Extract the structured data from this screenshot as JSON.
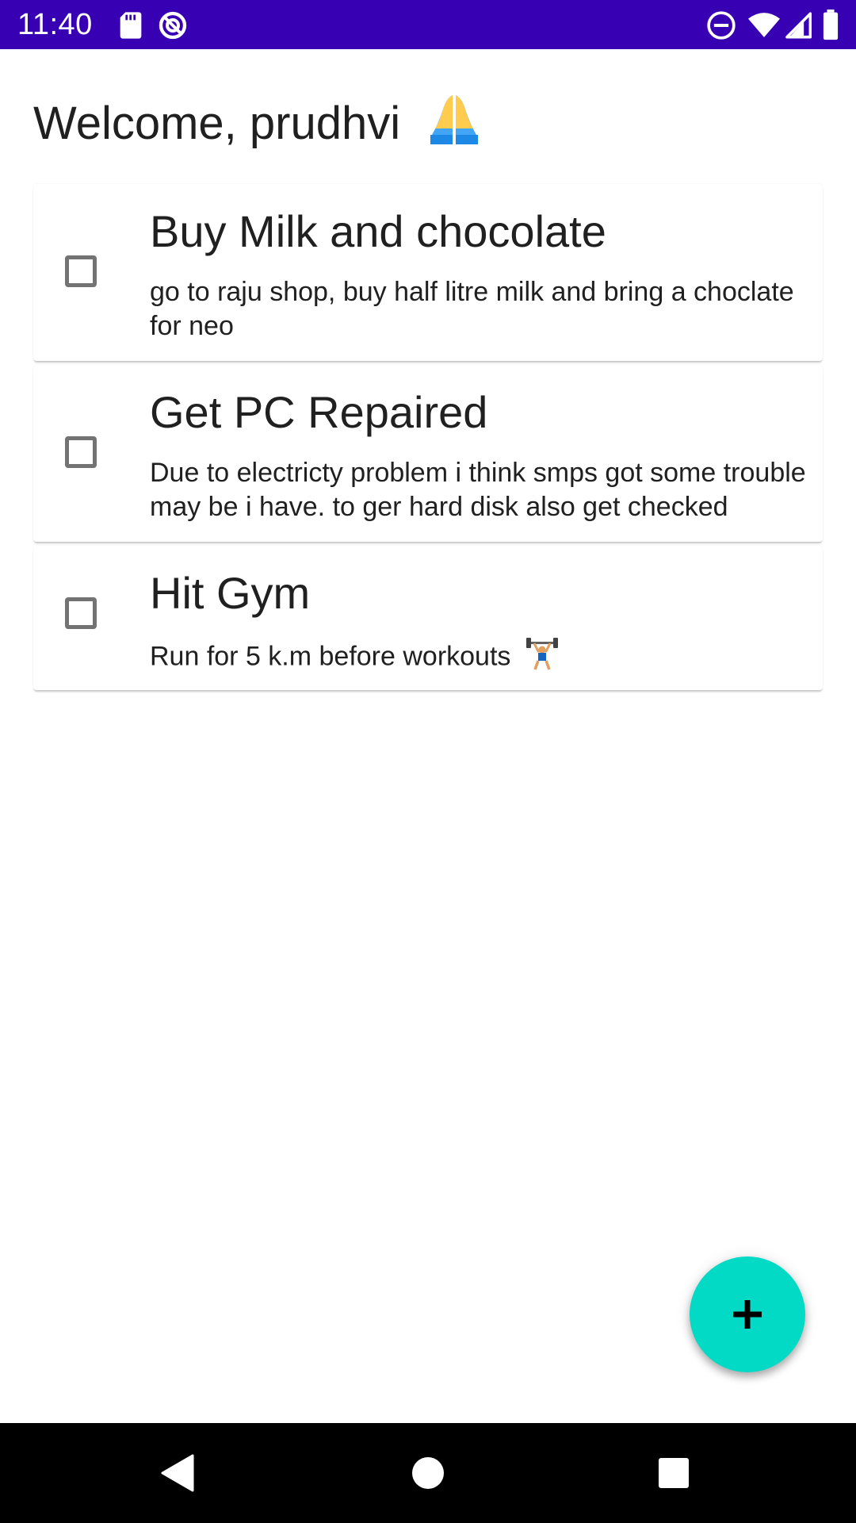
{
  "status_bar": {
    "time": "11:40",
    "background_color": "#3700b3",
    "left_icons": [
      "sd-card-icon",
      "data-saver-icon"
    ],
    "right_icons": [
      "do-not-disturb-icon",
      "wifi-icon",
      "cell-signal-icon",
      "battery-icon"
    ]
  },
  "header": {
    "title": "Welcome, prudhvi",
    "emoji": "folded-hands-icon"
  },
  "tasks": [
    {
      "title": "Buy Milk and chocolate",
      "description": "go to raju shop, buy half litre milk and bring a choclate for neo",
      "checked": false
    },
    {
      "title": "Get PC Repaired",
      "description": "Due to electricty problem i think smps got some trouble may be i have. to ger hard disk also get checked",
      "checked": false
    },
    {
      "title": "Hit Gym",
      "description": "Run for 5 k.m before workouts",
      "description_emoji": "weight-lifter-icon",
      "checked": false
    }
  ],
  "fab": {
    "icon": "plus-icon",
    "color": "#03dac5"
  },
  "nav_bar": {
    "buttons": [
      "back-icon",
      "home-icon",
      "recents-icon"
    ]
  }
}
